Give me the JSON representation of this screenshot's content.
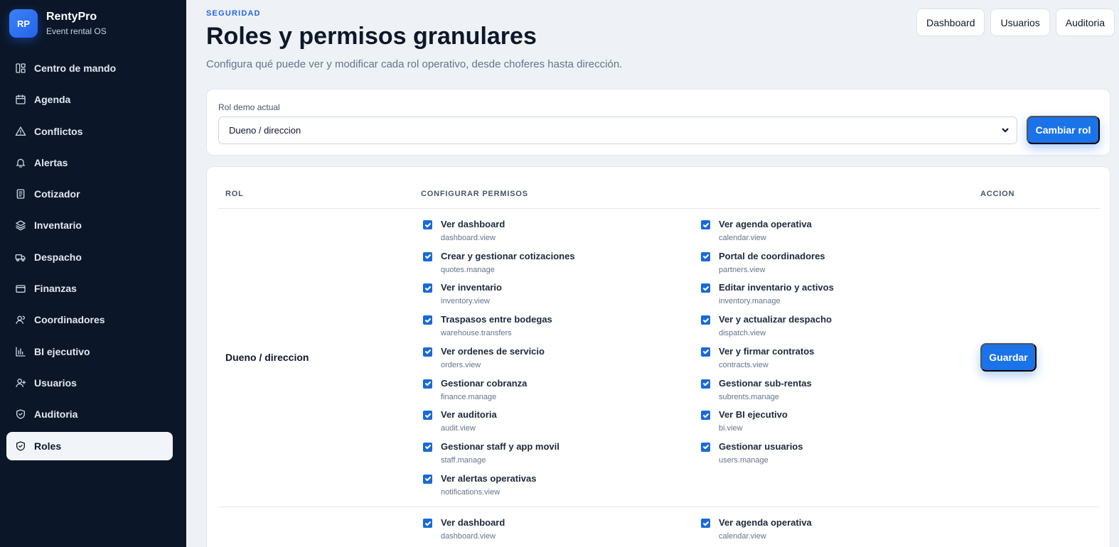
{
  "brand": {
    "initials": "RP",
    "name": "RentyPro",
    "subtitle": "Event rental OS"
  },
  "sidebar": {
    "items": [
      {
        "label": "Centro de mando",
        "icon": "dashboard-icon"
      },
      {
        "label": "Agenda",
        "icon": "calendar-icon"
      },
      {
        "label": "Conflictos",
        "icon": "warning-icon"
      },
      {
        "label": "Alertas",
        "icon": "bell-icon"
      },
      {
        "label": "Cotizador",
        "icon": "document-icon"
      },
      {
        "label": "Inventario",
        "icon": "layers-icon"
      },
      {
        "label": "Despacho",
        "icon": "truck-icon"
      },
      {
        "label": "Finanzas",
        "icon": "wallet-icon"
      },
      {
        "label": "Coordinadores",
        "icon": "users-icon"
      },
      {
        "label": "BI ejecutivo",
        "icon": "bar-chart-icon"
      },
      {
        "label": "Usuarios",
        "icon": "user-plus-icon"
      },
      {
        "label": "Auditoria",
        "icon": "shield-check-icon"
      },
      {
        "label": "Roles",
        "icon": "shield-icon",
        "active": true
      }
    ]
  },
  "header": {
    "kicker": "SEGURIDAD",
    "title": "Roles y permisos granulares",
    "subtitle": "Configura qué puede ver y modificar cada rol operativo, desde choferes hasta dirección.",
    "actions": [
      "Dashboard",
      "Usuarios",
      "Auditoria"
    ]
  },
  "role_selector": {
    "label": "Rol demo actual",
    "value": "Dueno / direccion",
    "button": "Cambiar rol"
  },
  "table": {
    "headers": {
      "role": "ROL",
      "permissions": "CONFIGURAR PERMISOS",
      "action": "ACCION"
    },
    "rows": [
      {
        "role": "Dueno / direccion",
        "action": "Guardar",
        "permissions": [
          {
            "label": "Ver dashboard",
            "key": "dashboard.view",
            "checked": true
          },
          {
            "label": "Ver agenda operativa",
            "key": "calendar.view",
            "checked": true
          },
          {
            "label": "Crear y gestionar cotizaciones",
            "key": "quotes.manage",
            "checked": true
          },
          {
            "label": "Portal de coordinadores",
            "key": "partners.view",
            "checked": true
          },
          {
            "label": "Ver inventario",
            "key": "inventory.view",
            "checked": true
          },
          {
            "label": "Editar inventario y activos",
            "key": "inventory.manage",
            "checked": true
          },
          {
            "label": "Traspasos entre bodegas",
            "key": "warehouse.transfers",
            "checked": true
          },
          {
            "label": "Ver y actualizar despacho",
            "key": "dispatch.view",
            "checked": true
          },
          {
            "label": "Ver ordenes de servicio",
            "key": "orders.view",
            "checked": true
          },
          {
            "label": "Ver y firmar contratos",
            "key": "contracts.view",
            "checked": true
          },
          {
            "label": "Gestionar cobranza",
            "key": "finance.manage",
            "checked": true
          },
          {
            "label": "Gestionar sub-rentas",
            "key": "subrents.manage",
            "checked": true
          },
          {
            "label": "Ver auditoria",
            "key": "audit.view",
            "checked": true
          },
          {
            "label": "Ver BI ejecutivo",
            "key": "bi.view",
            "checked": true
          },
          {
            "label": "Gestionar staff y app movil",
            "key": "staff.manage",
            "checked": true
          },
          {
            "label": "Gestionar usuarios",
            "key": "users.manage",
            "checked": true
          },
          {
            "label": "Ver alertas operativas",
            "key": "notifications.view",
            "checked": true
          }
        ]
      },
      {
        "role": "",
        "permissions": [
          {
            "label": "Ver dashboard",
            "key": "dashboard.view",
            "checked": true
          },
          {
            "label": "Ver agenda operativa",
            "key": "calendar.view",
            "checked": true
          }
        ]
      }
    ]
  }
}
